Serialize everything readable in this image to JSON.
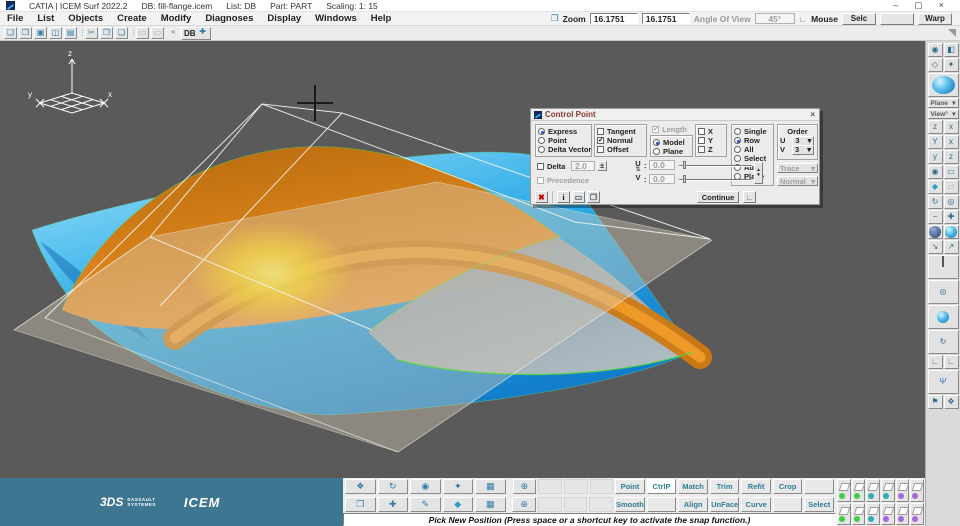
{
  "titlebar": {
    "app_title": "CATIA | ICEM Surf 2022.2",
    "db": "DB: fill-flange.icem",
    "list": "List: DB",
    "part": "Part: PART",
    "scaling": "Scaling: 1: 15",
    "minimize": "–",
    "maximize": "▢",
    "close": "×"
  },
  "menubar": {
    "items": [
      "File",
      "List",
      "Objects",
      "Create",
      "Modify",
      "Diagnoses",
      "Display",
      "Windows",
      "Help"
    ]
  },
  "zoombar": {
    "zoom_label": "Zoom",
    "zoom_value_1": "16.1751",
    "zoom_value_2": "16.1751",
    "angle_label": "Angle Of View",
    "angle_value": "45°",
    "mouse_label": "Mouse",
    "selc_button": "Selc",
    "middle_button": "",
    "warp_button": "Warp"
  },
  "toolbar": {
    "db_label": "DB"
  },
  "viewport": {
    "triad": {
      "x": "x",
      "y": "y",
      "z": "z"
    }
  },
  "dialog": {
    "title": "Control Point",
    "close": "×",
    "mode_group": {
      "options": [
        "Express",
        "Point",
        "Delta Vector"
      ],
      "selected": "Express"
    },
    "vector_group": {
      "options": [
        "Tangent",
        "Normal",
        "Offset"
      ],
      "checked": "Normal",
      "checkmark": "✓"
    },
    "length_label": "Length",
    "space_group": {
      "options": [
        "Model",
        "Plane"
      ],
      "selected": "Model"
    },
    "axis_group": {
      "options": [
        "X",
        "Y",
        "Z"
      ]
    },
    "selection_group": {
      "options": [
        "Single",
        "Row",
        "All",
        "Select",
        "Auto",
        "Plane"
      ],
      "selected": "Row"
    },
    "order": {
      "label": "Order",
      "u_label": "U",
      "u_value": "3",
      "v_label": "V",
      "v_value": "3",
      "arrow": "▾"
    },
    "delta": {
      "label": "Delta",
      "value": "2.0",
      "plusminus": "±"
    },
    "precedence_label": "Precedence",
    "uv": {
      "u_label": "U",
      "swap": "⇅",
      "v_label": "V",
      "colon": ":",
      "u_value": "0.0",
      "v_value": "0.0",
      "spinner_up": "▴",
      "spinner_down": "▾"
    },
    "trace_dropdown": "Trace",
    "normal_dropdown": "Normal",
    "dd_arrow": "▾",
    "continue_button": "Continue",
    "footer_icons": {
      "cancel": "✖",
      "info": "i",
      "screen": "▭",
      "windows": "❐",
      "corner": "∟"
    }
  },
  "bottom_toolbar": {
    "row1": [
      "Point",
      "CtrlP",
      "Match",
      "Trim",
      "Refit",
      "Crop",
      ""
    ],
    "row2": [
      "Smooth",
      "",
      "Align",
      "UnFace",
      "Curve",
      "",
      "Select"
    ],
    "active_button": "CtrlP"
  },
  "status_bar": {
    "message": "Pick New Position (Press space or a shortcut key to activate the snap function.)"
  },
  "branding": {
    "mark": "3DS",
    "dassault_line1": "DASSAULT",
    "dassault_line2": "SYSTEMES",
    "icem": "ICEM"
  },
  "right_panel": {
    "plane_dropdown": "Plane",
    "view_dropdown": "View°",
    "dd_arrow": "▾"
  },
  "icons": {
    "zoom": "❐",
    "angle_corner": "∟",
    "top_toolbar": [
      {
        "name": "new-file",
        "glyph": "❏"
      },
      {
        "name": "open-file",
        "glyph": "❒"
      },
      {
        "name": "save-file",
        "glyph": "▣"
      },
      {
        "name": "save-image",
        "glyph": "◫"
      },
      {
        "name": "print",
        "glyph": "▤"
      },
      {
        "name": "cut",
        "glyph": "✂"
      },
      {
        "name": "copy",
        "glyph": "❐"
      },
      {
        "name": "paste",
        "glyph": "❑"
      },
      {
        "name": "window-a",
        "glyph": "▭"
      },
      {
        "name": "window-b",
        "glyph": "▭"
      },
      {
        "name": "back",
        "glyph": "◂"
      },
      {
        "name": "add-db",
        "glyph": "✚"
      }
    ],
    "bottom_row1": [
      {
        "name": "transform",
        "glyph": "❖"
      },
      {
        "name": "orbit-camera",
        "glyph": "↻"
      },
      {
        "name": "visibility-eye",
        "glyph": "◉"
      },
      {
        "name": "light",
        "glyph": "✦"
      },
      {
        "name": "snapshot",
        "glyph": "▦"
      },
      {
        "name": "globe",
        "glyph": "⊕"
      }
    ],
    "bottom_row2": [
      {
        "name": "folder",
        "glyph": "❒"
      },
      {
        "name": "move",
        "glyph": "✚"
      },
      {
        "name": "sketch-pen",
        "glyph": "✎"
      },
      {
        "name": "eraser",
        "glyph": "◆"
      },
      {
        "name": "windows-grid",
        "glyph": "▦"
      },
      {
        "name": "globe-flash",
        "glyph": "⊕"
      }
    ],
    "right_small": [
      {
        "name": "eye-options",
        "glyph": "◉"
      },
      {
        "name": "render-mode",
        "glyph": "◧"
      },
      {
        "name": "cube-display",
        "glyph": "◇"
      },
      {
        "name": "light-bulb",
        "glyph": "✦"
      },
      {
        "name": "view-z",
        "glyph": "z"
      },
      {
        "name": "view-x",
        "glyph": "x"
      },
      {
        "name": "view-y-front",
        "glyph": "Y"
      },
      {
        "name": "view-x-side",
        "glyph": "x"
      },
      {
        "name": "view-y-top",
        "glyph": "y"
      },
      {
        "name": "view-z-iso",
        "glyph": "z"
      },
      {
        "name": "hide-eye",
        "glyph": "◉"
      },
      {
        "name": "screen",
        "glyph": "▭"
      },
      {
        "name": "eraser",
        "glyph": "◆"
      },
      {
        "name": "clear",
        "glyph": "▱"
      },
      {
        "name": "orbit",
        "glyph": "↻"
      },
      {
        "name": "find",
        "glyph": "◎"
      },
      {
        "name": "zoom-out",
        "glyph": "−"
      },
      {
        "name": "zoom-in",
        "glyph": "✚"
      },
      {
        "name": "resize-a",
        "glyph": "↘"
      },
      {
        "name": "resize-b",
        "glyph": "↗"
      },
      {
        "name": "axis-a",
        "glyph": "∟"
      },
      {
        "name": "axis-b",
        "glyph": "∟"
      },
      {
        "name": "flag",
        "glyph": "⚑"
      },
      {
        "name": "move-all",
        "glyph": "✥"
      }
    ],
    "right_wide": [
      {
        "name": "find-wide",
        "glyph": "◎"
      },
      {
        "name": "orbit-wide",
        "glyph": "↻"
      },
      {
        "name": "fork-tool",
        "glyph": "Ψ"
      }
    ]
  },
  "colors": {
    "brand_teal": "#3e7691",
    "viewport_bg": "#5a5a5a",
    "surface_blue": "#29a8e8",
    "surface_orange": "#d9821a",
    "highlight_yellow": "#ffe000",
    "button_text": "#2e7d96",
    "dialog_title": "#8a3a2a"
  }
}
